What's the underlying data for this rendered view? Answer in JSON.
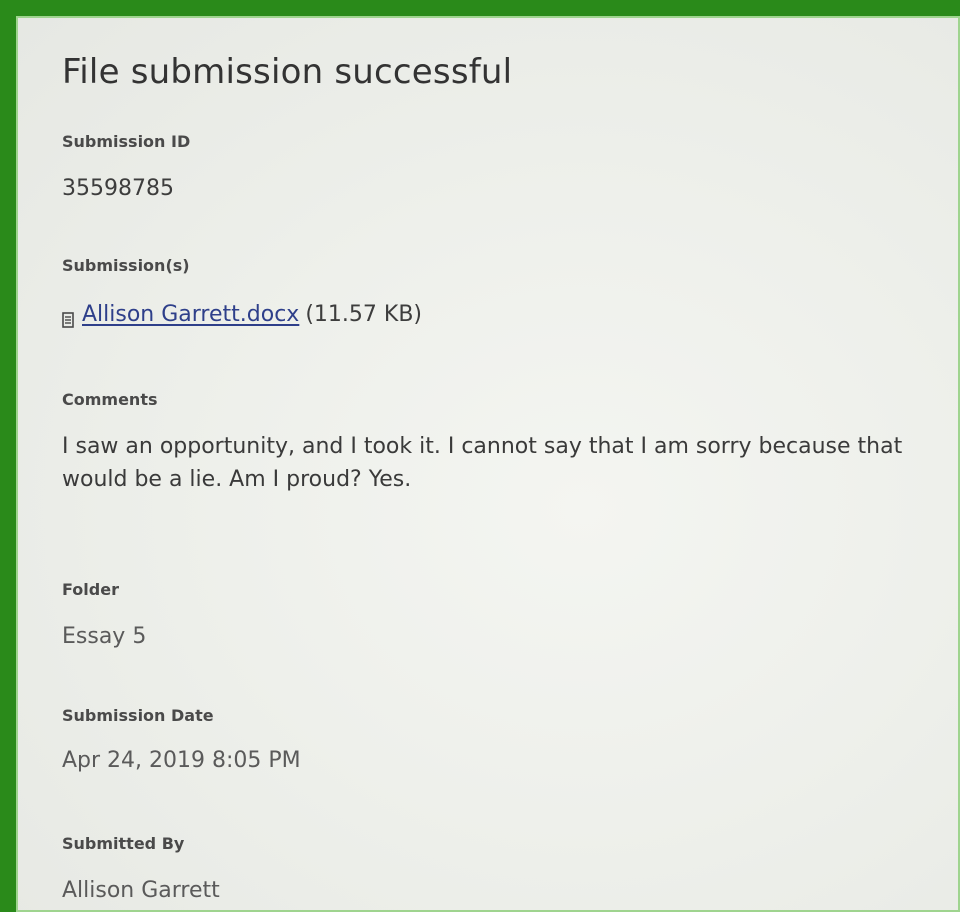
{
  "header": {
    "title": "File submission successful"
  },
  "submission_id": {
    "label": "Submission ID",
    "value": "35598785"
  },
  "submissions": {
    "label": "Submission(s)",
    "files": [
      {
        "name": "Allison Garrett.docx",
        "size": "(11.57 KB)",
        "icon": "document-icon"
      }
    ]
  },
  "comments": {
    "label": "Comments",
    "text": "I saw an opportunity, and I took it. I cannot say that I am sorry because that would be a lie. Am I proud? Yes."
  },
  "folder": {
    "label": "Folder",
    "value": "Essay 5"
  },
  "submission_date": {
    "label": "Submission Date",
    "value": "Apr 24, 2019 8:05 PM"
  },
  "submitted_by": {
    "label": "Submitted By",
    "value": "Allison Garrett"
  },
  "colors": {
    "frame": "#2a8a1a",
    "link": "#2e3f8a",
    "background": "#eef0eb"
  }
}
